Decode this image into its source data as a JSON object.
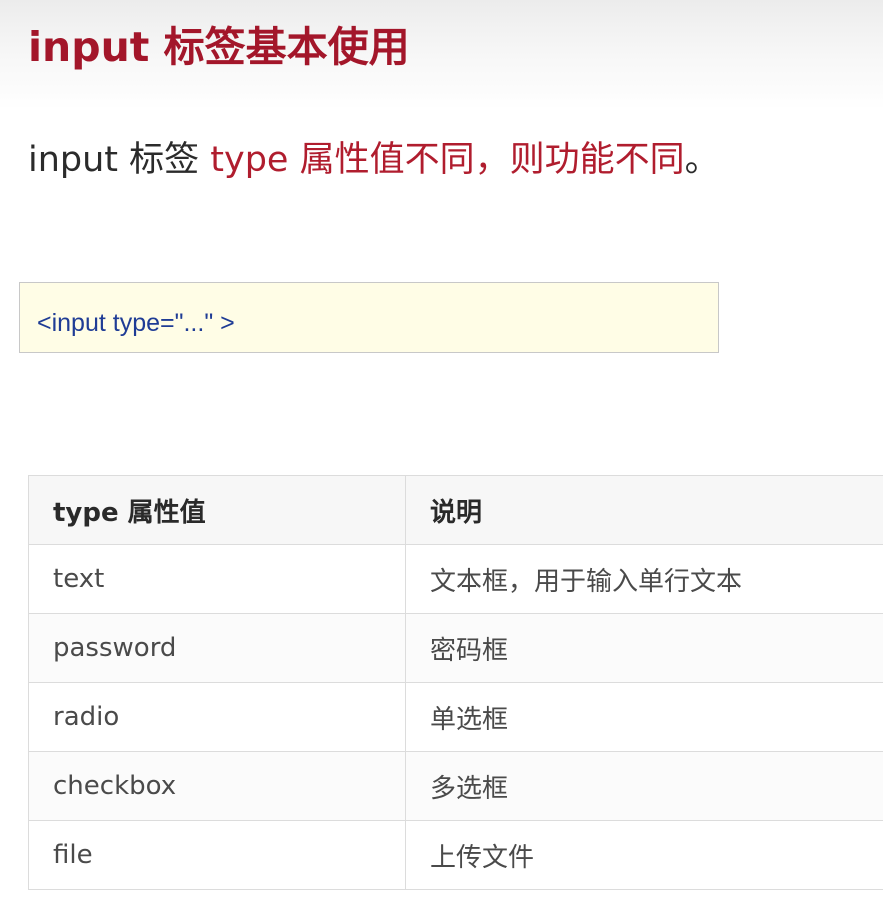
{
  "title": "input 标签基本使用",
  "subtitle": {
    "part1": "input 标签 ",
    "part2": "type 属性值不同，则功能不同",
    "part3": "。"
  },
  "code": "<input type=\"...\" >",
  "table": {
    "headers": [
      "type 属性值",
      "说明"
    ],
    "rows": [
      [
        "text",
        "文本框，用于输入单行文本"
      ],
      [
        "password",
        "密码框"
      ],
      [
        "radio",
        "单选框"
      ],
      [
        "checkbox",
        "多选框"
      ],
      [
        "file",
        "上传文件"
      ]
    ]
  },
  "colors": {
    "title": "#a3162a",
    "accent": "#b01d2e",
    "code_text": "#1f3c95",
    "code_bg": "#fffde6"
  }
}
